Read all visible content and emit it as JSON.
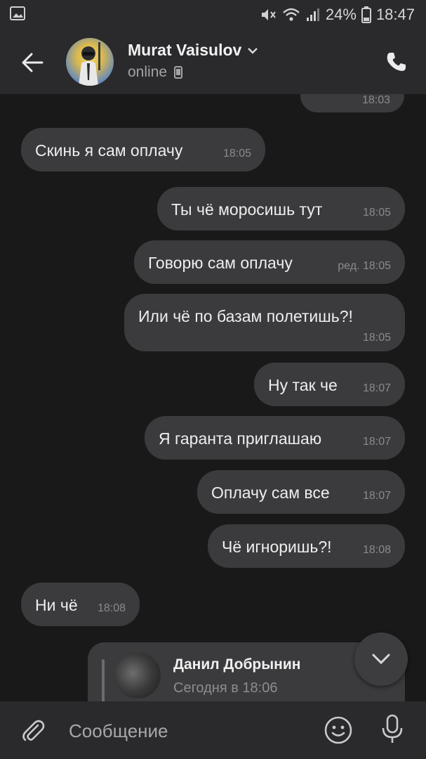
{
  "status_bar": {
    "battery": "24%",
    "time": "18:47"
  },
  "header": {
    "name": "Murat Vaisulov",
    "status": "online"
  },
  "messages": [
    {
      "text": "",
      "time": "18:03"
    },
    {
      "text": "Скинь я сам оплачу",
      "time": "18:05"
    },
    {
      "text": "Ты чё моросишь тут",
      "time": "18:05"
    },
    {
      "text": "Говорю сам оплачу",
      "time": "ред. 18:05"
    },
    {
      "text": "Или чё по базам полетишь?!",
      "time": "18:05"
    },
    {
      "text": "Ну так че",
      "time": "18:07"
    },
    {
      "text": "Я гаранта приглашаю",
      "time": "18:07"
    },
    {
      "text": "Оплачу сам все",
      "time": "18:07"
    },
    {
      "text": "Чё игноришь?!",
      "time": "18:08"
    },
    {
      "text": "Ни чё",
      "time": "18:08"
    }
  ],
  "reply": {
    "name": "Данил Добрынин",
    "date": "Сегодня в 18:06"
  },
  "input": {
    "placeholder": "Сообщение"
  }
}
